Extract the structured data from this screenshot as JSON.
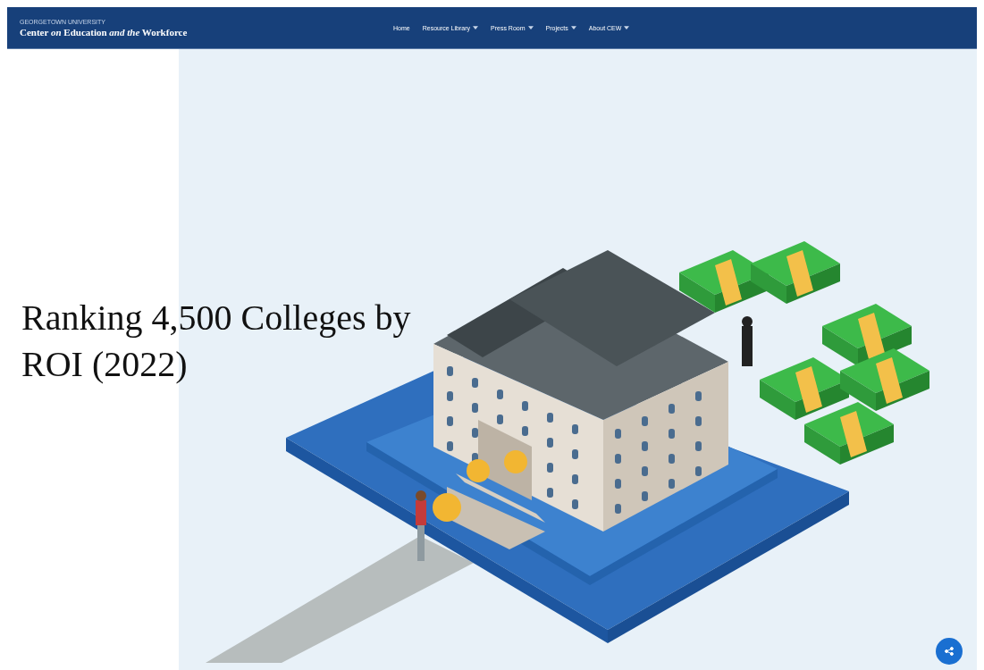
{
  "header": {
    "logo_overline": "GEORGETOWN UNIVERSITY",
    "logo": "Center *on* Education *and the* Workforce",
    "nav": [
      {
        "label": "Home",
        "has_menu": false
      },
      {
        "label": "Resource Library",
        "has_menu": true
      },
      {
        "label": "Press Room",
        "has_menu": true
      },
      {
        "label": "Projects",
        "has_menu": true
      },
      {
        "label": "About CEW",
        "has_menu": true
      }
    ]
  },
  "hero": {
    "title": "Ranking 4,500 Colleges by ROI (2022)"
  }
}
